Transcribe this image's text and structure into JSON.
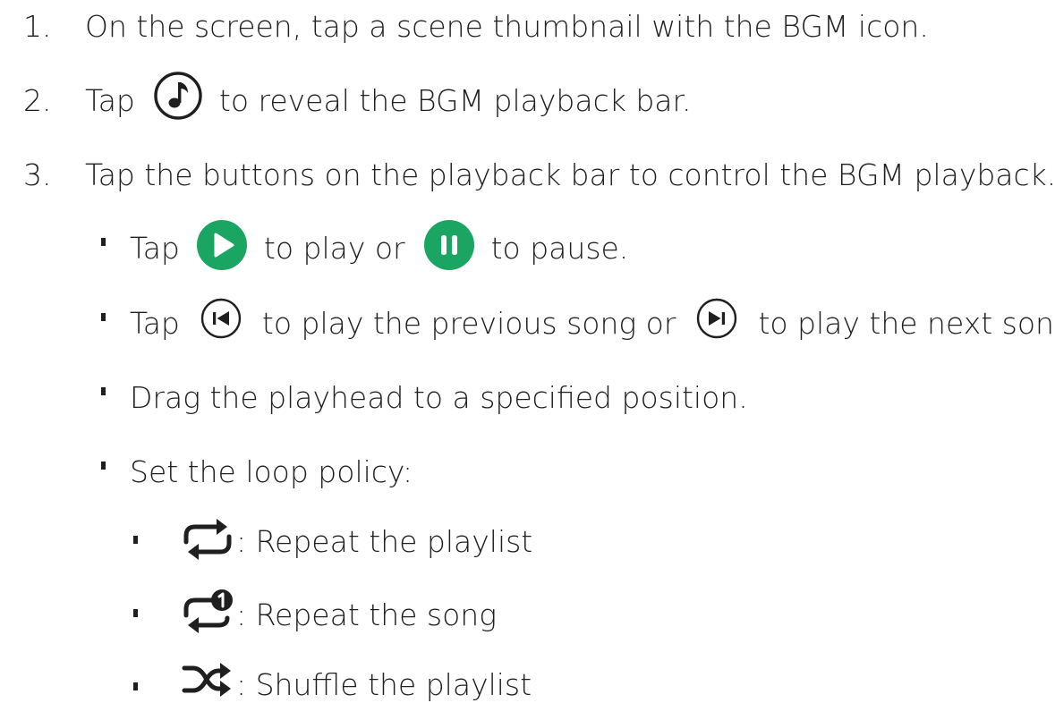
{
  "steps": [
    {
      "number": "1.",
      "text": "On the screen, tap a scene thumbnail with the BGM icon."
    },
    {
      "number": "2.",
      "before": "Tap",
      "icon": "music-note-circle-icon",
      "after": "to reveal the BGM playback bar."
    },
    {
      "number": "3.",
      "text": "Tap the buttons on the playback bar to control the BGM playback."
    }
  ],
  "bullets": {
    "play_pause": {
      "before": "Tap",
      "play_icon": "play-icon",
      "middle": "to play or",
      "pause_icon": "pause-icon",
      "after": "to pause."
    },
    "prev_next": {
      "before": "Tap",
      "prev_icon": "previous-icon",
      "middle": "to play the previous song or",
      "next_icon": "next-icon",
      "after": "to play the next song."
    },
    "drag": {
      "text": "Drag the playhead to a specified position."
    },
    "loop": {
      "text": "Set the loop policy:"
    }
  },
  "loop_options": [
    {
      "icon": "repeat-playlist-icon",
      "text": ": Repeat the playlist"
    },
    {
      "icon": "repeat-song-icon",
      "text": ": Repeat the song"
    },
    {
      "icon": "shuffle-icon",
      "text": ": Shuffle the playlist"
    }
  ],
  "colors": {
    "text": "#1f1f1f",
    "accent_green": "#1aa562"
  }
}
